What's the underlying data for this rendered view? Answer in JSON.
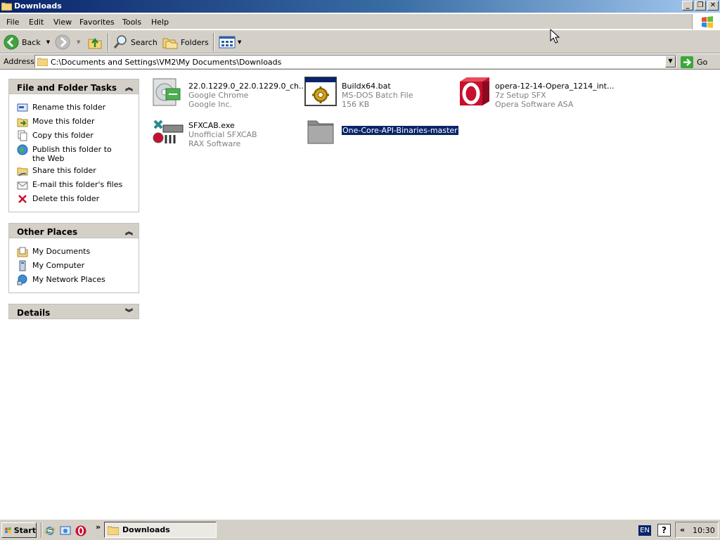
{
  "window": {
    "title": "Downloads",
    "controls": [
      "minimize",
      "maximize",
      "close"
    ]
  },
  "menu": [
    "File",
    "Edit",
    "View",
    "Favorites",
    "Tools",
    "Help"
  ],
  "toolbar": {
    "back_label": "Back",
    "search_label": "Search",
    "folders_label": "Folders"
  },
  "address": {
    "label": "Address",
    "value": "C:\\Documents and Settings\\VM2\\My Documents\\Downloads",
    "go_label": "Go"
  },
  "panels": {
    "tasks": {
      "title": "File and Folder Tasks",
      "items": [
        {
          "label": "Rename this folder",
          "icon": "rename-icon"
        },
        {
          "label": "Move this folder",
          "icon": "move-icon"
        },
        {
          "label": "Copy this folder",
          "icon": "copy-icon"
        },
        {
          "label": "Publish this folder to the Web",
          "icon": "globe-icon"
        },
        {
          "label": "Share this folder",
          "icon": "share-icon"
        },
        {
          "label": "E-mail this folder's files",
          "icon": "email-icon"
        },
        {
          "label": "Delete this folder",
          "icon": "delete-icon"
        }
      ]
    },
    "places": {
      "title": "Other Places",
      "items": [
        {
          "label": "My Documents",
          "icon": "my-documents-icon"
        },
        {
          "label": "My Computer",
          "icon": "my-computer-icon"
        },
        {
          "label": "My Network Places",
          "icon": "network-places-icon"
        }
      ]
    },
    "details": {
      "title": "Details"
    }
  },
  "files": [
    {
      "name": "22.0.1229.0_22.0.1229.0_ch...",
      "line2": "Google Chrome",
      "line3": "Google Inc.",
      "icon": "installer-icon"
    },
    {
      "name": "Buildx64.bat",
      "line2": "MS-DOS Batch File",
      "line3": "156 KB",
      "icon": "batch-file-icon"
    },
    {
      "name": "opera-12-14-Opera_1214_int...",
      "line2": "7z Setup SFX",
      "line3": "Opera Software ASA",
      "icon": "opera-icon"
    },
    {
      "name": "SFXCAB.exe",
      "line2": "Unofficial SFXCAB",
      "line3": "RAX Software",
      "icon": "sfxcab-icon"
    },
    {
      "name": "One-Core-API-Binaries-master",
      "icon": "folder-icon",
      "selected": true
    }
  ],
  "taskbar": {
    "start_label": "Start",
    "window_button_label": "Downloads",
    "language": "EN",
    "clock": "10:30",
    "chevron": "»",
    "tray_chevron": "«"
  },
  "colors": {
    "title_gradient_start": "#0a246a",
    "title_gradient_end": "#a6caf0",
    "chrome_face": "#d4d0c8",
    "selection": "#0a246a"
  }
}
